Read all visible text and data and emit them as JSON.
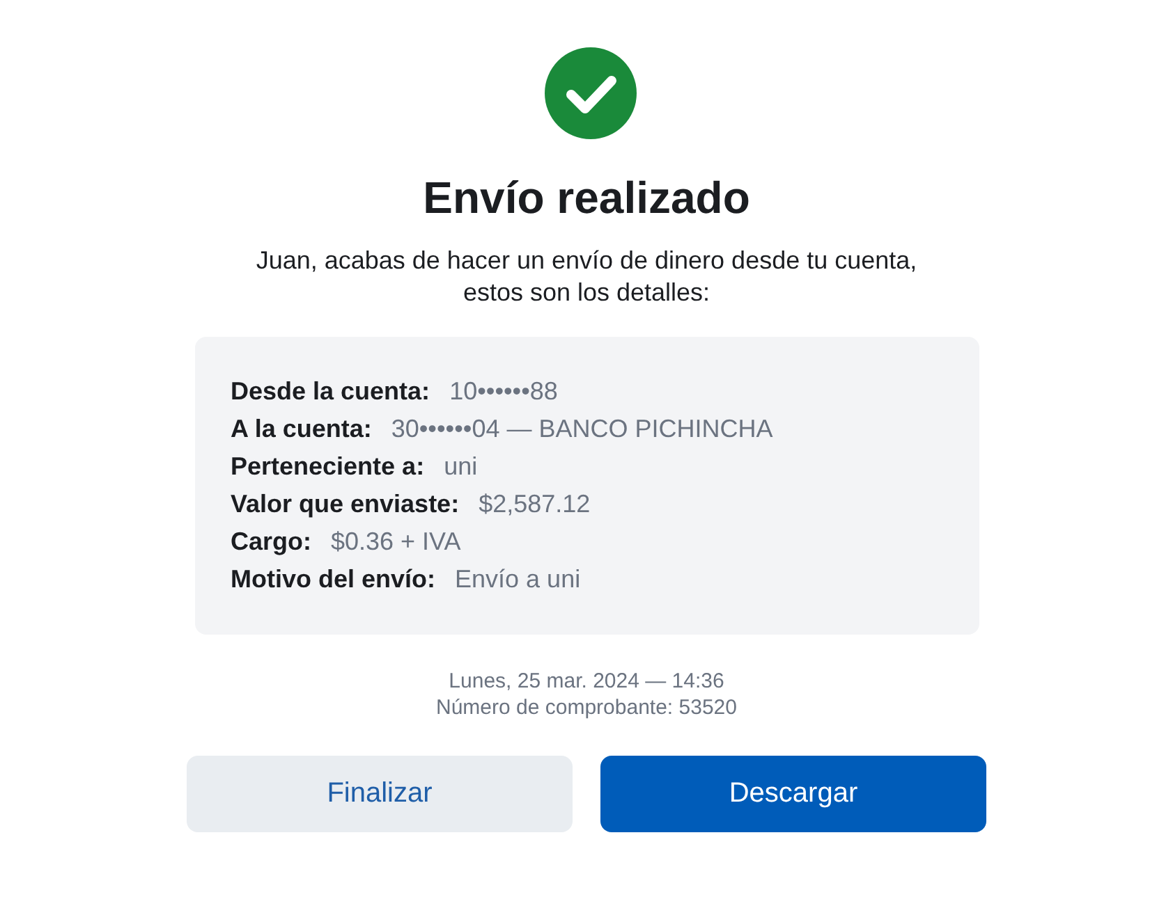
{
  "title": "Envío realizado",
  "message": "Juan, acabas de hacer un envío de dinero desde tu cuenta, estos son los detalles:",
  "details": [
    {
      "label": "Desde la cuenta:",
      "value": "10••••••88"
    },
    {
      "label": "A la cuenta:",
      "value": "30••••••04 — BANCO PICHINCHA"
    },
    {
      "label": "Perteneciente a:",
      "value": "uni"
    },
    {
      "label": "Valor que enviaste:",
      "value": "$2,587.12"
    },
    {
      "label": "Cargo:",
      "value": "$0.36 + IVA"
    },
    {
      "label": "Motivo del envío:",
      "value": "Envío a uni"
    }
  ],
  "date": "Lunes, 25 mar. 2024 — 14:36",
  "receipt": "Número de comprobante: 53520",
  "buttons": [
    {
      "label": "Finalizar",
      "kind": "secondary"
    },
    {
      "label": "Descargar",
      "kind": "primary"
    }
  ]
}
